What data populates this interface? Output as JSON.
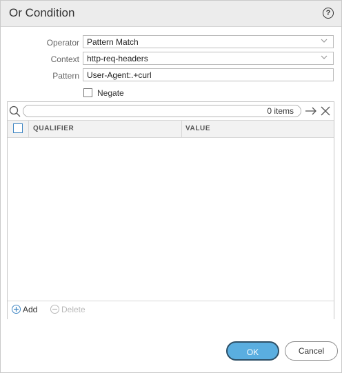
{
  "dialog": {
    "title": "Or Condition",
    "help_icon": "question-circle-icon",
    "help_glyph": "?"
  },
  "form": {
    "operator": {
      "label": "Operator",
      "value": "Pattern Match"
    },
    "context": {
      "label": "Context",
      "value": "http-req-headers"
    },
    "pattern": {
      "label": "Pattern",
      "value": "User-Agent:.+curl"
    },
    "negate": {
      "label": "Negate",
      "checked": false
    }
  },
  "grid": {
    "search": {
      "placeholder": "",
      "count_text": "0 items"
    },
    "columns": [
      "QUALIFIER",
      "VALUE"
    ],
    "rows": [],
    "footer": {
      "add_label": "Add",
      "delete_label": "Delete"
    }
  },
  "buttons": {
    "ok_label": "OK",
    "cancel_label": "Cancel"
  },
  "colors": {
    "accent": "#5aaee0",
    "header_bg": "#ececec",
    "checkbox_border": "#3f86c3",
    "add": "#3f86c3",
    "disabled": "#b8b8b8"
  }
}
